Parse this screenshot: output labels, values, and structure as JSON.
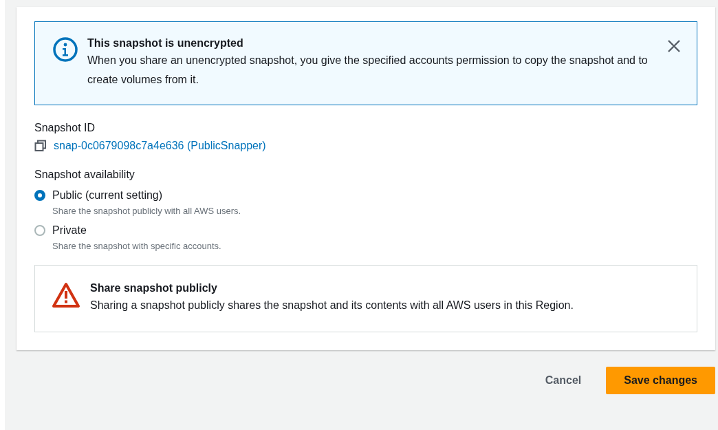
{
  "info_alert": {
    "title": "This snapshot is unencrypted",
    "message": "When you share an unencrypted snapshot, you give the specified accounts permission to copy the snapshot and to create volumes from it."
  },
  "snapshot_id": {
    "label": "Snapshot ID",
    "value": "snap-0c0679098c7a4e636 (PublicSnapper)"
  },
  "availability": {
    "label": "Snapshot availability",
    "options": [
      {
        "label": "Public (current setting)",
        "description": "Share the snapshot publicly with all AWS users.",
        "selected": true
      },
      {
        "label": "Private",
        "description": "Share the snapshot with specific accounts.",
        "selected": false
      }
    ]
  },
  "warning_alert": {
    "title": "Share snapshot publicly",
    "message": "Sharing a snapshot publicly shares the snapshot and its contents with all AWS users in this Region."
  },
  "buttons": {
    "cancel": "Cancel",
    "save": "Save changes"
  }
}
